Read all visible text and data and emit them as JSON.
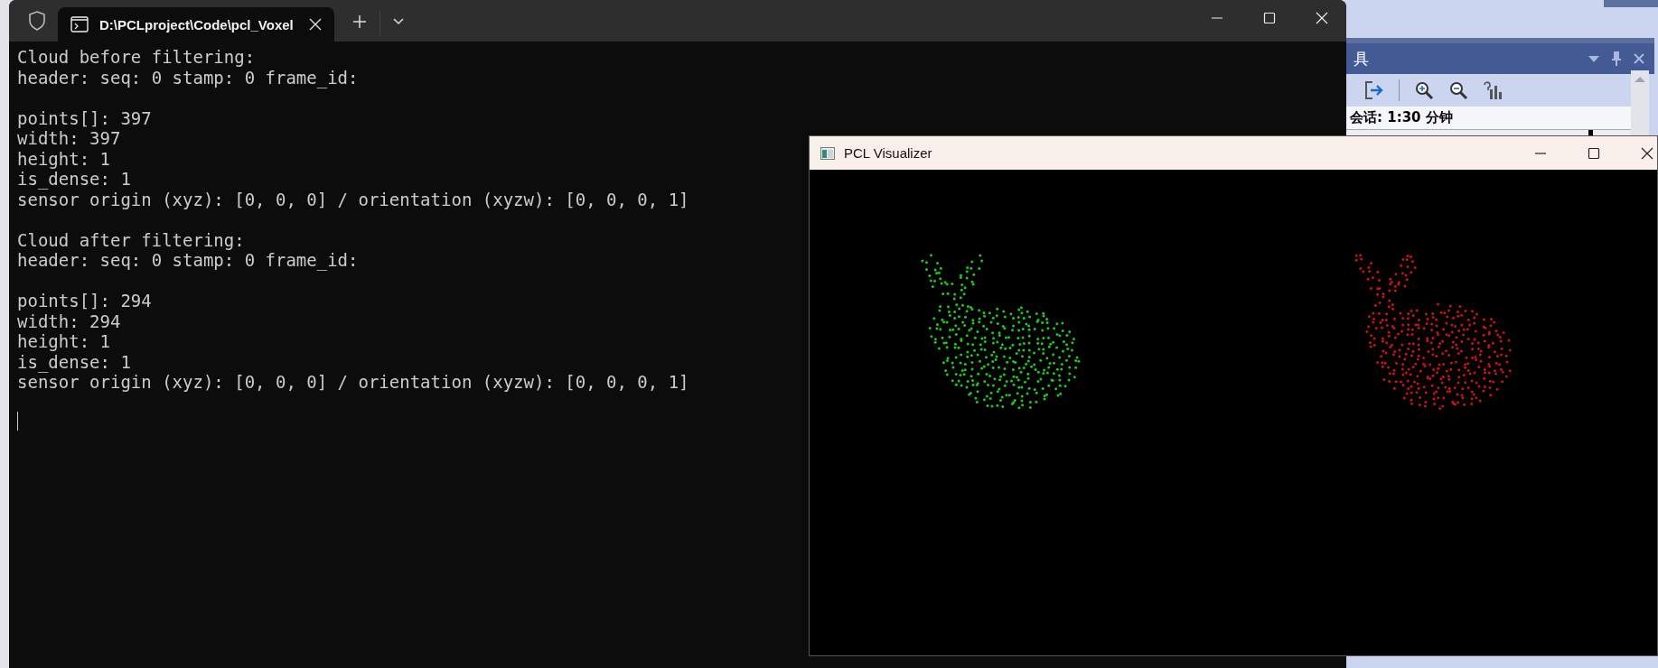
{
  "background_window": {
    "panel_title": "具",
    "session": "会话: 1:30 分钟"
  },
  "terminal": {
    "tab": {
      "title": "D:\\PCLproject\\Code\\pcl_Voxel",
      "selected": true
    },
    "blocks": [
      {
        "lines": [
          "Cloud before filtering:",
          "header: seq: 0 stamp: 0 frame_id:"
        ]
      },
      {
        "lines": [
          "points[]: 397",
          "width: 397",
          "height: 1",
          "is_dense: 1",
          "sensor origin (xyz): [0, 0, 0] / orientation (xyzw): [0, 0, 0, 1]"
        ]
      },
      {
        "lines": [
          "Cloud after filtering:",
          "header: seq: 0 stamp: 0 frame_id:"
        ]
      },
      {
        "lines": [
          "points[]: 294",
          "width: 294",
          "height: 1",
          "is_dense: 1",
          "sensor origin (xyz): [0, 0, 0] / orientation (xyzw): [0, 0, 0, 1]"
        ]
      }
    ]
  },
  "visualizer": {
    "title": "PCL Visualizer",
    "clouds": [
      {
        "color": "#1ec81e"
      },
      {
        "color": "#c81414"
      }
    ]
  }
}
